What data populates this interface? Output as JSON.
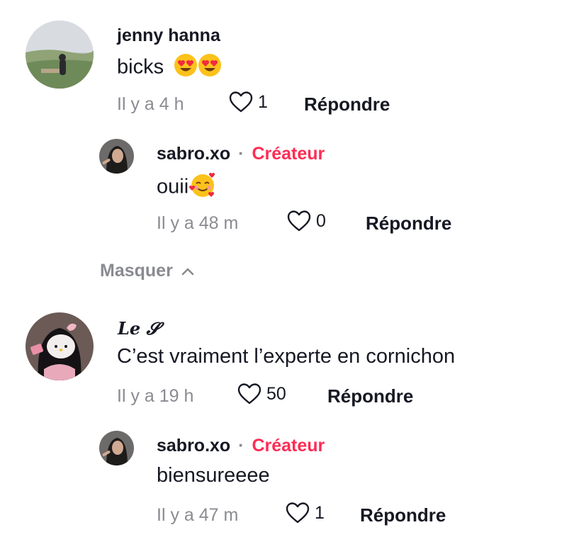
{
  "comments": [
    {
      "author": "jenny hanna",
      "text": "bicks",
      "emojis": [
        "heart-eyes",
        "heart-eyes"
      ],
      "time": "Il y a 4 h",
      "likes": "1",
      "reply_label": "Répondre",
      "replies": [
        {
          "author": "sabro.xo",
          "separator": "·",
          "badge": "Créateur",
          "text": "ouii",
          "emojis": [
            "smiling-with-hearts"
          ],
          "time": "Il y a 48 m",
          "likes": "0",
          "reply_label": "Répondre"
        }
      ],
      "hide_label": "Masquer"
    },
    {
      "author": "Le 𝓢",
      "text": "C’est vraiment l’experte en cornichon",
      "time": "Il y a 19 h",
      "likes": "50",
      "reply_label": "Répondre",
      "replies": [
        {
          "author": "sabro.xo",
          "separator": "·",
          "badge": "Créateur",
          "text": "biensureeee",
          "time": "Il y a 47 m",
          "likes": "1",
          "reply_label": "Répondre"
        }
      ]
    }
  ],
  "colors": {
    "creator_badge": "#fe2c55",
    "muted": "#8a8b91",
    "text": "#161823"
  }
}
